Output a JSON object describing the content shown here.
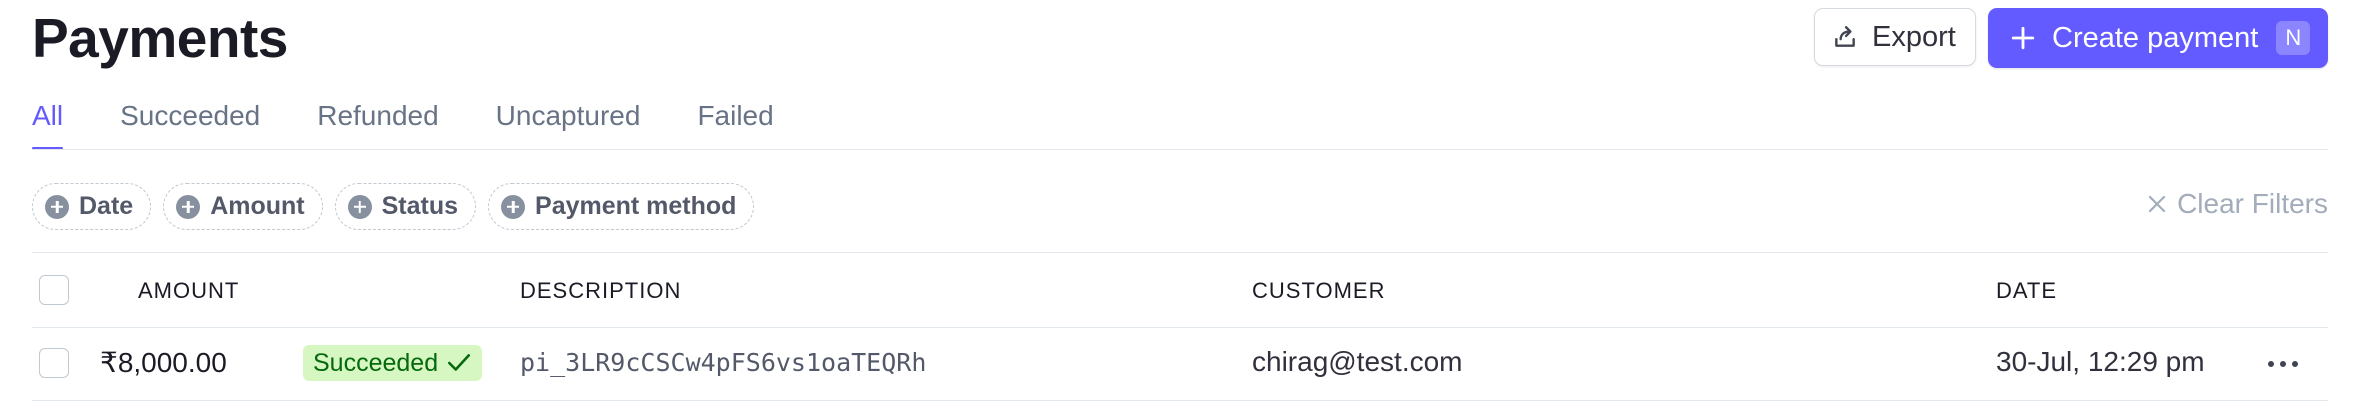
{
  "header": {
    "title": "Payments",
    "export_label": "Export",
    "create_label": "Create payment",
    "create_shortcut": "N"
  },
  "tabs": [
    {
      "label": "All",
      "active": true
    },
    {
      "label": "Succeeded",
      "active": false
    },
    {
      "label": "Refunded",
      "active": false
    },
    {
      "label": "Uncaptured",
      "active": false
    },
    {
      "label": "Failed",
      "active": false
    }
  ],
  "filters": {
    "chips": [
      "Date",
      "Amount",
      "Status",
      "Payment method"
    ],
    "clear_label": "Clear Filters"
  },
  "table": {
    "columns": [
      "AMOUNT",
      "DESCRIPTION",
      "CUSTOMER",
      "DATE"
    ],
    "rows": [
      {
        "amount": "₹8,000.00",
        "status": "Succeeded",
        "description": "pi_3LR9cCSCw4pFS6vs1oaTEQRh",
        "customer": "chirag@test.com",
        "date": "30-Jul, 12:29 pm"
      }
    ]
  },
  "icons": {
    "export": "export-icon",
    "create": "plus-icon",
    "filter_add": "plus-circle-icon",
    "clear": "close-icon",
    "status_check": "check-icon",
    "row_menu": "more-horizontal-icon"
  },
  "colors": {
    "accent": "#635bff",
    "success_bg": "#d7f7c2",
    "success_text": "#05690d",
    "muted": "#687385"
  }
}
